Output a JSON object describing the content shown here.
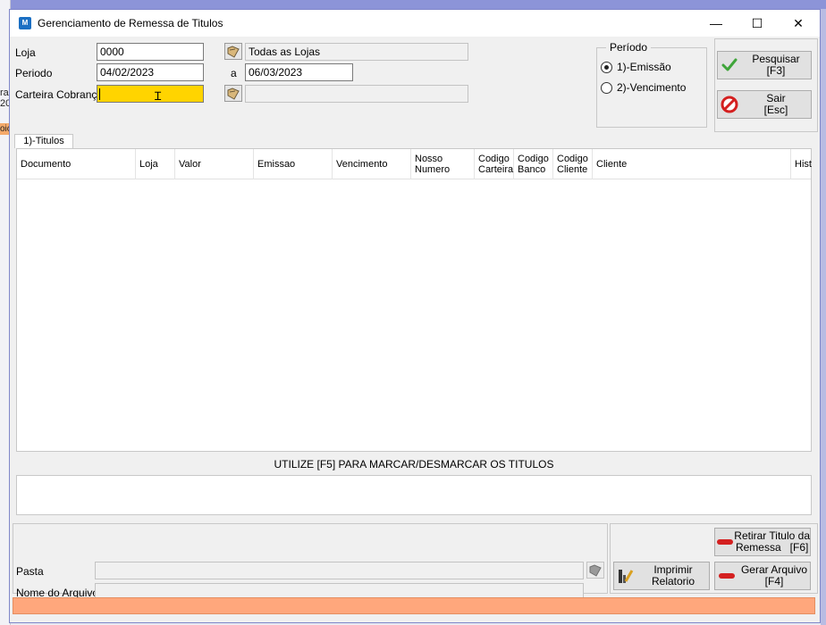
{
  "window": {
    "title": "Gerenciamento de Remessa de Titulos",
    "minimize_glyph": "—",
    "maximize_glyph": "☐",
    "close_glyph": "✕"
  },
  "background": {
    "left_text_1": "ra",
    "left_text_2": "20",
    "left_badge": "oic"
  },
  "filters": {
    "loja_label": "Loja",
    "loja_value": "0000",
    "loja_desc": "Todas as Lojas",
    "periodo_label": "Periodo",
    "periodo_start": "04/02/2023",
    "periodo_sep": "a",
    "periodo_end": "06/03/2023",
    "carteira_label": "Carteira Cobrança",
    "carteira_value": "",
    "carteira_desc": ""
  },
  "periodo_group": {
    "title": "Período",
    "options": [
      {
        "label": "1)-Emissão",
        "selected": true
      },
      {
        "label": "2)-Vencimento",
        "selected": false
      }
    ]
  },
  "actions": {
    "pesquisar": "Pesquisar\n[F3]",
    "sair": "Sair\n[Esc]",
    "retirar": "Retirar Titulo da\nRemessa   [F6]",
    "gerar": "Gerar Arquivo\n[F4]",
    "imprimir": "Imprimir\nRelatorio"
  },
  "tabs": [
    {
      "label": "1)-Titulos"
    }
  ],
  "grid": {
    "columns": [
      "Documento",
      "Loja",
      "Valor",
      "Emissao",
      "Vencimento",
      "Nosso\nNumero",
      "Codigo\nCarteira",
      "Codigo\nBanco",
      "Codigo\nCliente",
      "Cliente",
      "Hist"
    ],
    "hint": "UTILIZE [F5] PARA MARCAR/DESMARCAR OS TITULOS"
  },
  "output": {
    "pasta_label": "Pasta",
    "pasta_value": "",
    "arquivo_label": "Nome do Arquivo",
    "arquivo_value": ""
  },
  "colors": {
    "field_highlight": "#ffd400",
    "status_bar": "#ffa77c",
    "check_green": "#3fa53a",
    "stop_red": "#d42020"
  }
}
